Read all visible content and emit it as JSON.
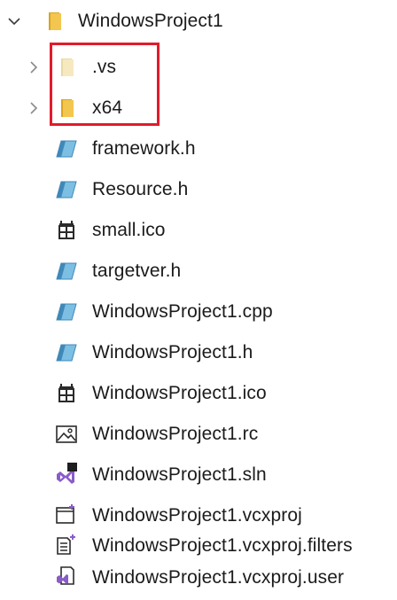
{
  "tree": {
    "root": {
      "label": "WindowsProject1",
      "expanded": true,
      "icon": "folder-icon"
    },
    "children": [
      {
        "label": ".vs",
        "type": "folder",
        "icon": "folder-icon",
        "expandable": true,
        "highlighted": true
      },
      {
        "label": "x64",
        "type": "folder",
        "icon": "folder-icon",
        "expandable": true,
        "highlighted": true
      },
      {
        "label": "framework.h",
        "type": "file",
        "icon": "header-file-icon"
      },
      {
        "label": "Resource.h",
        "type": "file",
        "icon": "header-file-icon"
      },
      {
        "label": "small.ico",
        "type": "file",
        "icon": "ico-file-icon"
      },
      {
        "label": "targetver.h",
        "type": "file",
        "icon": "header-file-icon"
      },
      {
        "label": "WindowsProject1.cpp",
        "type": "file",
        "icon": "cpp-file-icon"
      },
      {
        "label": "WindowsProject1.h",
        "type": "file",
        "icon": "header-file-icon"
      },
      {
        "label": "WindowsProject1.ico",
        "type": "file",
        "icon": "ico-file-icon"
      },
      {
        "label": "WindowsProject1.rc",
        "type": "file",
        "icon": "rc-file-icon"
      },
      {
        "label": "WindowsProject1.sln",
        "type": "file",
        "icon": "sln-file-icon"
      },
      {
        "label": "WindowsProject1.vcxproj",
        "type": "file",
        "icon": "vcxproj-file-icon"
      },
      {
        "label": "WindowsProject1.vcxproj.filters",
        "type": "file",
        "icon": "filters-file-icon"
      },
      {
        "label": "WindowsProject1.vcxproj.user",
        "type": "file",
        "icon": "user-file-icon"
      }
    ]
  },
  "colors": {
    "highlight": "#e21b2b",
    "folder": "#f3c64f",
    "folder_dark": "#d9a520",
    "header_file": "#5aa4cf",
    "vs_purple": "#6f3ba8",
    "text": "#1b1b1b"
  }
}
